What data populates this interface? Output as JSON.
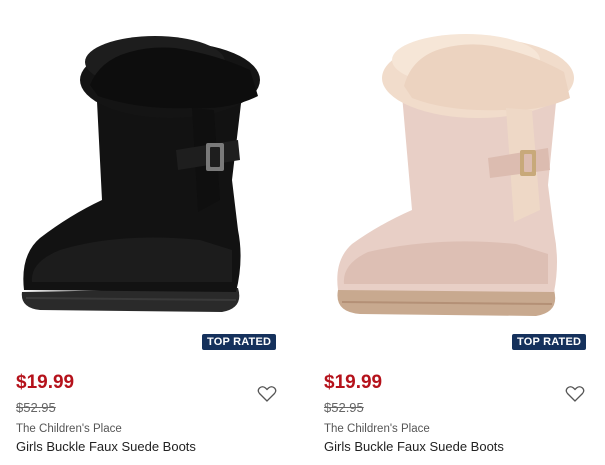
{
  "products": [
    {
      "badge": "TOP RATED",
      "price": "$19.99",
      "original_price": "$52.95",
      "brand": "The Children's Place",
      "title": "Girls Buckle Faux Suede Boots",
      "color": "#121212",
      "fur_color": "#141414"
    },
    {
      "badge": "TOP RATED",
      "price": "$19.99",
      "original_price": "$52.95",
      "brand": "The Children's Place",
      "title": "Girls Buckle Faux Suede Boots",
      "color": "#e8cfc6",
      "fur_color": "#f1dccb"
    }
  ],
  "icons": {
    "wishlist": "heart-outline-icon"
  }
}
